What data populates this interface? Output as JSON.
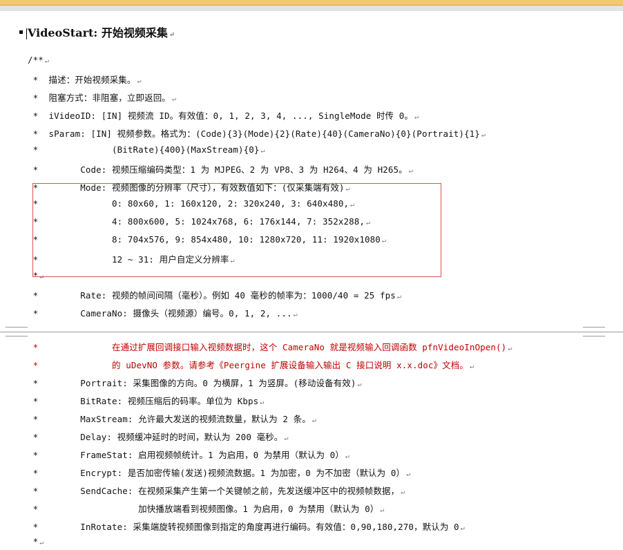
{
  "heading": {
    "text": "VideoStart: 开始视频采集",
    "mark": "↵"
  },
  "mark": "↵",
  "lines": [
    "/**",
    " *  描述：开始视频采集。",
    " *  阻塞方式：非阻塞，立即返回。",
    " *  iVideoID: [IN] 视频流 ID。有效值：0, 1, 2, 3, 4, ..., SingleMode 时传 0。",
    " *  sParam: [IN] 视频参数。格式为：(Code){3}(Mode){2}(Rate){40}(CameraNo){0}(Portrait){1}",
    " *              (BitRate){400}(MaxStream){0}",
    " *        Code: 视频压缩编码类型：1 为 MJPEG、2 为 VP8、3 为 H264、4 为 H265。",
    " *        Mode: 视频图像的分辨率（尺寸），有效数值如下：(仅采集端有效)",
    " *              0: 80x60, 1: 160x120, 2: 320x240, 3: 640x480,",
    " *              4: 800x600, 5: 1024x768, 6: 176x144, 7: 352x288,",
    " *              8: 704x576, 9: 854x480, 10: 1280x720, 11: 1920x1080",
    " *              12 ~ 31: 用户自定义分辨率",
    " *",
    " *        Rate: 视频的帧间间隔（毫秒）。例如 40 毫秒的帧率为：1000/40 = 25 fps",
    " *        CameraNo: 摄像头（视频源）编号。0, 1, 2, ...",
    " *              在通过扩展回调接口输入视频数据时，这个 CameraNo 就是视频输入回调函数 pfnVideoInOpen()",
    " *              的 uDevNO 参数。请参考《Peergine 扩展设备输入输出 C 接口说明 x.x.doc》文档。",
    " *        Portrait: 采集图像的方向。0 为横屏，1 为竖屏。(移动设备有效)",
    " *        BitRate: 视频压缩后的码率。单位为 Kbps",
    " *        MaxStream: 允许最大发送的视频流数量，默认为 2 条。",
    " *        Delay: 视频缓冲延时的时间，默认为 200 毫秒。",
    " *        FrameStat: 启用视频帧统计。1 为启用，0 为禁用（默认为 0）",
    " *        Encrypt: 是否加密传输(发送)视频流数据。1 为加密，0 为不加密（默认为 0）",
    " *        SendCache: 在视频采集产生第一个关键帧之前，先发送缓冲区中的视频帧数据，",
    " *                   加快播放端看到视频图像。1 为启用，0 为禁用（默认为 0）",
    " *        InRotate: 采集端旋转视频图像到指定的角度再进行编码。有效值：0,90,180,270，默认为 0",
    " *"
  ],
  "colors": {
    "red_text": "#c00000",
    "box_border": "#d9534f",
    "gold_bar": "#f3c96b"
  }
}
